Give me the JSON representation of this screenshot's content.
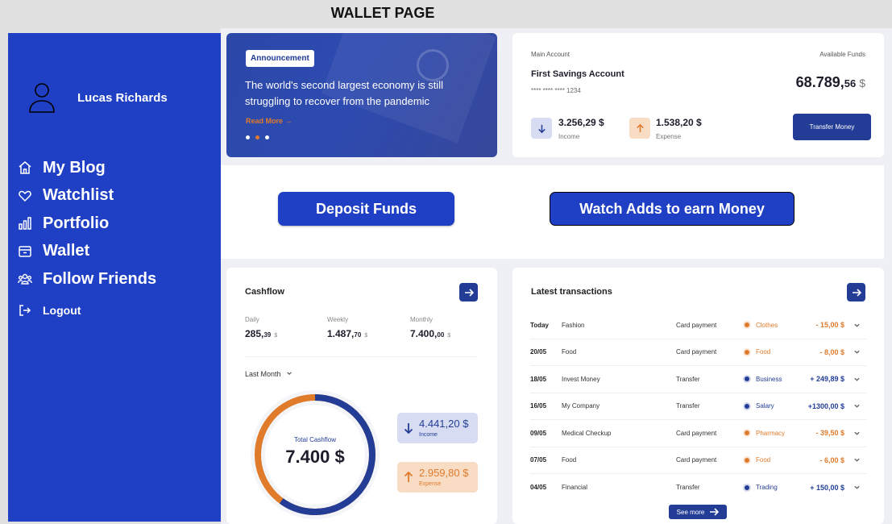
{
  "page_title": "WALLET PAGE",
  "sidebar": {
    "username": "Lucas Richards",
    "items": [
      {
        "label": "My Blog"
      },
      {
        "label": "Watchlist"
      },
      {
        "label": "Portfolio"
      },
      {
        "label": "Wallet"
      },
      {
        "label": "Follow Friends"
      }
    ],
    "logout": "Logout"
  },
  "announcement": {
    "badge": "Announcement",
    "text": "The world's second largest economy is still struggling to recover from the pandemic",
    "read_more": "Read More →"
  },
  "account": {
    "main_label": "Main Account",
    "funds_label": "Available Funds",
    "name": "First Savings Account",
    "number": "**** **** ****   1234",
    "balance_main": "68.789,",
    "balance_cents": "56",
    "currency": "$",
    "income_value": "3.256,29 $",
    "income_label": "Income",
    "expense_value": "1.538,20 $",
    "expense_label": "Expense",
    "transfer_label": "Transfer Money"
  },
  "actions": {
    "deposit": "Deposit Funds",
    "watch": "Watch Adds to earn Money"
  },
  "cashflow": {
    "title": "Cashflow",
    "daily_label": "Daily",
    "daily_main": "285,",
    "daily_cents": "39",
    "daily_cur": "$",
    "weekly_label": "Weekly",
    "weekly_main": "1.487,",
    "weekly_cents": "70",
    "weekly_cur": "$",
    "monthly_label": "Monthly",
    "monthly_main": "7.400,",
    "monthly_cents": "00",
    "monthly_cur": "$",
    "filter": "Last Month",
    "total_label": "Total Cashflow",
    "total_value": "7.400 $",
    "income_value": "4.441,20 $",
    "income_label": "Income",
    "expense_value": "2.959,80 $",
    "expense_label": "Expense",
    "income_fraction": 0.6,
    "colors": {
      "income": "#233d97",
      "expense": "#e07b2c"
    }
  },
  "transactions": {
    "title": "Latest transactions",
    "see_more": "See more",
    "rows": [
      {
        "date": "Today",
        "name": "Fashion",
        "type": "Card payment",
        "category": "Clothes",
        "amount": "- 15,00 $",
        "kind": "expense"
      },
      {
        "date": "20/05",
        "name": "Food",
        "type": "Card payment",
        "category": "Food",
        "amount": "- 8,00 $",
        "kind": "expense"
      },
      {
        "date": "18/05",
        "name": "Invest Money",
        "type": "Transfer",
        "category": "Business",
        "amount": "+ 249,89 $",
        "kind": "income"
      },
      {
        "date": "16/05",
        "name": "My Company",
        "type": "Transfer",
        "category": "Salary",
        "amount": "+1300,00 $",
        "kind": "income"
      },
      {
        "date": "09/05",
        "name": "Medical Checkup",
        "type": "Card payment",
        "category": "Pharmacy",
        "amount": "- 39,50 $",
        "kind": "expense"
      },
      {
        "date": "07/05",
        "name": "Food",
        "type": "Card payment",
        "category": "Food",
        "amount": "- 6,00 $",
        "kind": "expense"
      },
      {
        "date": "04/05",
        "name": "Financial",
        "type": "Transfer",
        "category": "Trading",
        "amount": "+ 150,00 $",
        "kind": "income"
      }
    ],
    "colors": {
      "income": "#233d97",
      "expense": "#e07b2c"
    }
  }
}
